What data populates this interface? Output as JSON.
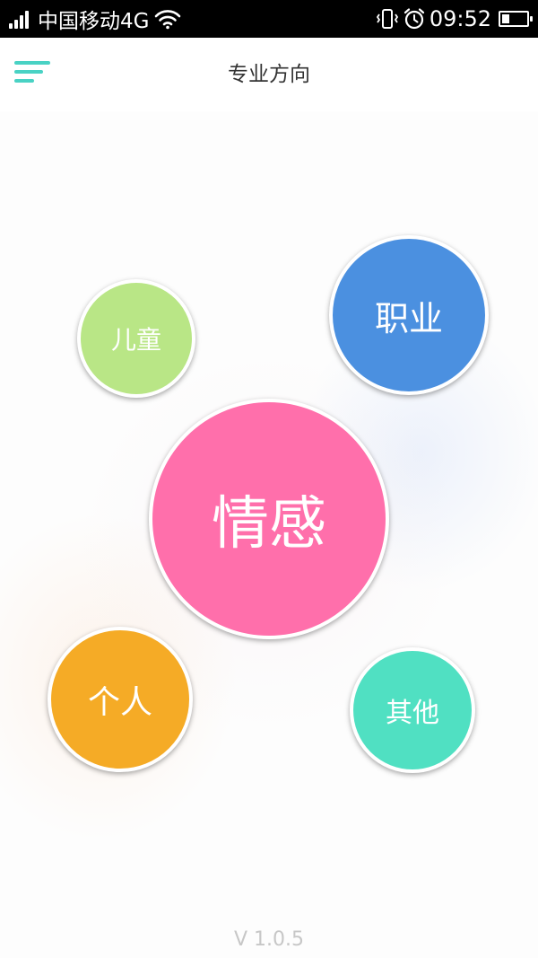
{
  "status_bar": {
    "carrier": "中国移动4G",
    "time": "09:52",
    "battery_level": 0.3,
    "icons": [
      "signal-icon",
      "wifi-icon",
      "vibrate-icon",
      "alarm-icon",
      "battery-icon"
    ]
  },
  "header": {
    "title": "专业方向",
    "menu_icon": "menu-icon",
    "accent_color": "#49d2c4"
  },
  "categories": {
    "child": {
      "label": "儿童",
      "color": "#b9e686"
    },
    "career": {
      "label": "职业",
      "color": "#4b90e0"
    },
    "emotion": {
      "label": "情感",
      "color": "#ff6fab"
    },
    "personal": {
      "label": "个人",
      "color": "#f5ab26"
    },
    "other": {
      "label": "其他",
      "color": "#50e0c2"
    }
  },
  "footer": {
    "version": "V 1.0.5"
  }
}
